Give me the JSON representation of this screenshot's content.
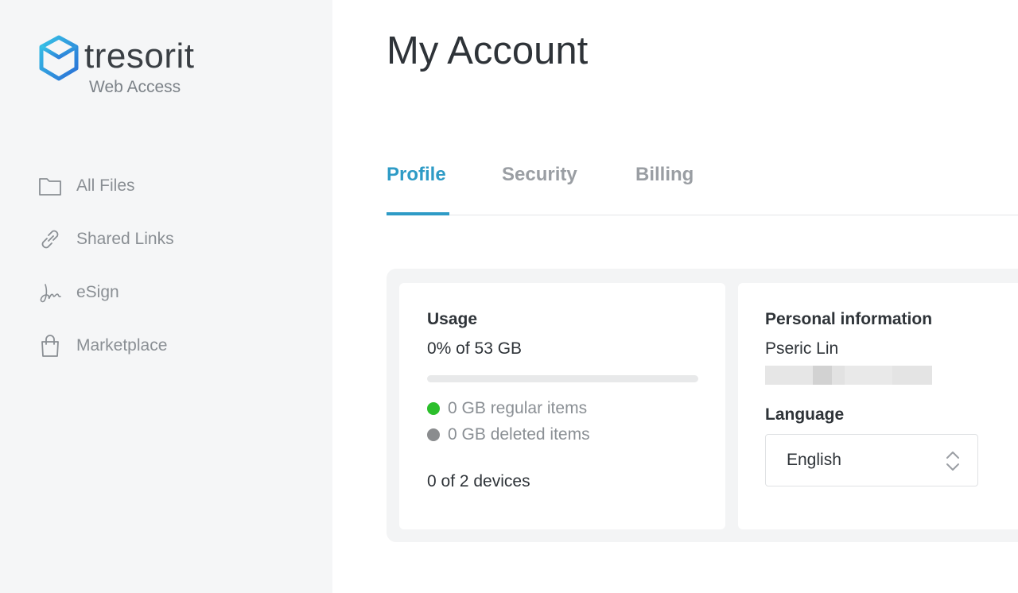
{
  "brand": {
    "name": "tresorit",
    "subtitle": "Web Access",
    "accent_color": "#2e9bc6",
    "logo_icon": "hexagon-cube-logo"
  },
  "sidebar": {
    "items": [
      {
        "label": "All Files",
        "icon": "folder-icon"
      },
      {
        "label": "Shared Links",
        "icon": "link-icon"
      },
      {
        "label": "eSign",
        "icon": "signature-icon"
      },
      {
        "label": "Marketplace",
        "icon": "shopping-bag-icon"
      }
    ]
  },
  "page": {
    "title": "My Account"
  },
  "tabs": [
    {
      "label": "Profile",
      "active": true
    },
    {
      "label": "Security",
      "active": false
    },
    {
      "label": "Billing",
      "active": false
    }
  ],
  "usage": {
    "title": "Usage",
    "summary": "0% of 53 GB",
    "progress_fraction": 0,
    "legend": [
      {
        "label": "0 GB regular items",
        "color": "#2bbf2b"
      },
      {
        "label": "0 GB deleted items",
        "color": "#8a8c8e"
      }
    ],
    "devices": "0 of 2 devices"
  },
  "personal": {
    "title": "Personal information",
    "name": "Pseric Lin",
    "language_label": "Language",
    "language_value": "English"
  }
}
